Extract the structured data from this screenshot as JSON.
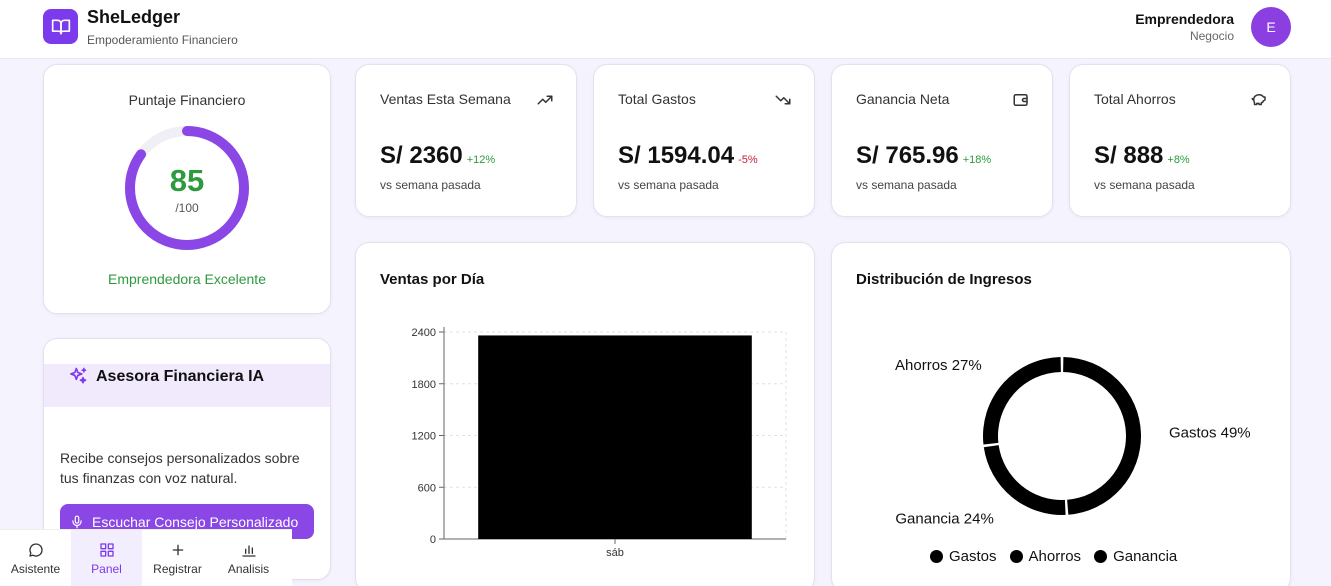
{
  "header": {
    "app_title": "SheLedger",
    "app_subtitle": "Empoderamiento Financiero",
    "user_name": "Emprendedora",
    "user_type": "Negocio",
    "avatar_initial": "E"
  },
  "score": {
    "title": "Puntaje Financiero",
    "value": "85",
    "max": "/100",
    "fraction": 0.85,
    "label": "Emprendedora Excelente"
  },
  "stats": [
    {
      "title": "Ventas Esta Semana",
      "value": "S/ 2360",
      "change": "+12%",
      "sub": "vs semana pasada",
      "icon": "trending-up-icon"
    },
    {
      "title": "Total Gastos",
      "value": "S/ 1594.04",
      "change": "-5%",
      "sub": "vs semana pasada",
      "icon": "trending-down-icon"
    },
    {
      "title": "Ganancia Neta",
      "value": "S/ 765.96",
      "change": "+18%",
      "sub": "vs semana pasada",
      "icon": "wallet-icon"
    },
    {
      "title": "Total Ahorros",
      "value": "S/ 888",
      "change": "+8%",
      "sub": "vs semana pasada",
      "icon": "piggy-bank-icon"
    }
  ],
  "advisor": {
    "title": "Asesora Financiera IA",
    "text": "Recibe consejos personalizados sobre tus finanzas con voz natural.",
    "button": "Escuchar Consejo Personalizado"
  },
  "nav": [
    {
      "label": "Asistente",
      "icon": "chat-icon"
    },
    {
      "label": "Panel",
      "icon": "grid-icon"
    },
    {
      "label": "Registrar",
      "icon": "plus-icon"
    },
    {
      "label": "Analisis",
      "icon": "bar-chart-icon"
    }
  ],
  "colors": {
    "accent": "#7c3aed",
    "positive": "#2e9a3e",
    "negative": "#c81e3a"
  },
  "bar_title": "Ventas por Día",
  "pie_title": "Distribución de Ingresos",
  "chart_data": [
    {
      "type": "bar",
      "title": "Ventas por Día",
      "categories": [
        "sáb"
      ],
      "values": [
        2360
      ],
      "ylim": [
        0,
        2400
      ],
      "yticks": [
        0,
        600,
        1200,
        1800,
        2400
      ],
      "grid": true
    },
    {
      "type": "pie",
      "title": "Distribución de Ingresos",
      "labels": [
        "Gastos",
        "Ahorros",
        "Ganancia"
      ],
      "values": [
        49,
        27,
        24
      ],
      "slice_labels": [
        "Gastos 49%",
        "Ahorros 27%",
        "Ganancia 24%"
      ],
      "donut": true,
      "legend": "bottom"
    }
  ]
}
